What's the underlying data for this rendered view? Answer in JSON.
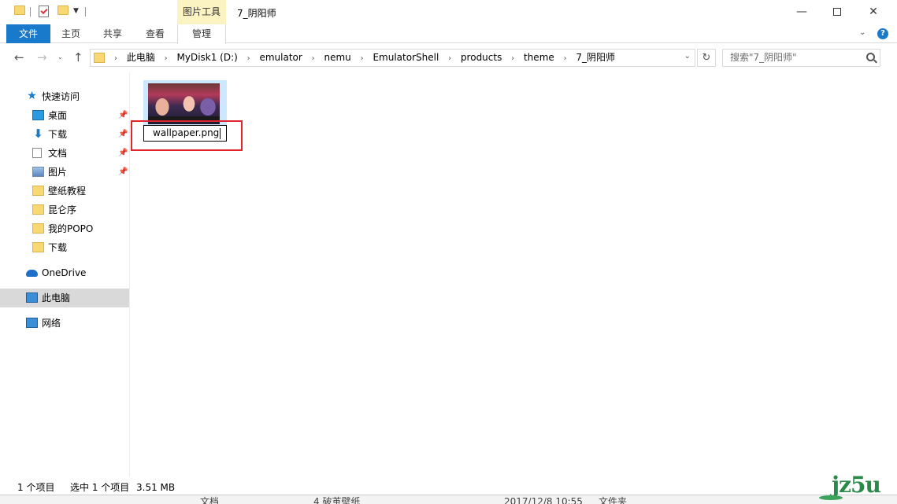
{
  "window": {
    "title": "7_阴阳师",
    "context_tab_group": "图片工具",
    "controls": {
      "minimize": "—",
      "close": "✕"
    }
  },
  "ribbon": {
    "tabs": [
      {
        "label": "文件",
        "active": true
      },
      {
        "label": "主页"
      },
      {
        "label": "共享"
      },
      {
        "label": "查看"
      },
      {
        "label": "管理"
      }
    ],
    "collapse_glyph": "⌄",
    "help_glyph": "?"
  },
  "nav": {
    "back": "←",
    "forward": "→",
    "recent": "⌄",
    "up": "↑",
    "refresh": "↻",
    "address_dropdown": "⌄"
  },
  "address": {
    "crumbs": [
      "此电脑",
      "MyDisk1 (D:)",
      "emulator",
      "nemu",
      "EmulatorShell",
      "products",
      "theme",
      "7_阴阳师"
    ],
    "separator": "›"
  },
  "search": {
    "placeholder": "搜索\"7_阴阳师\""
  },
  "navpane": {
    "quick_access": "快速访问",
    "quick_items": [
      {
        "label": "桌面",
        "icon": "desktop-icon",
        "pinned": true
      },
      {
        "label": "下载",
        "icon": "download-icon",
        "pinned": true
      },
      {
        "label": "文档",
        "icon": "document-icon",
        "pinned": true
      },
      {
        "label": "图片",
        "icon": "pictures-icon",
        "pinned": true
      },
      {
        "label": "壁纸教程",
        "icon": "folder-icon"
      },
      {
        "label": "昆仑序",
        "icon": "folder-icon"
      },
      {
        "label": "我的POPO",
        "icon": "folder-icon"
      },
      {
        "label": "下载",
        "icon": "folder-icon"
      }
    ],
    "onedrive": "OneDrive",
    "this_pc": "此电脑",
    "network": "网络",
    "pin_glyph": "📌"
  },
  "content": {
    "file": {
      "rename_value": "wallpaper.png",
      "thumbnail": "game-artwork-thumbnail"
    }
  },
  "status": {
    "item_count": "1 个项目",
    "selected": "选中 1 个项目",
    "size": "3.51 MB"
  },
  "peek": {
    "item1": "文档",
    "item2": "4 破茧壁纸",
    "item3": "2017/12/8 10:55",
    "item4": "文件夹"
  },
  "watermark": {
    "text": "jz5u"
  },
  "colors": {
    "accent": "#1979ca",
    "selection": "#cce8ff",
    "context_tab": "#fbf3c2",
    "highlight_border": "#e0262b"
  }
}
